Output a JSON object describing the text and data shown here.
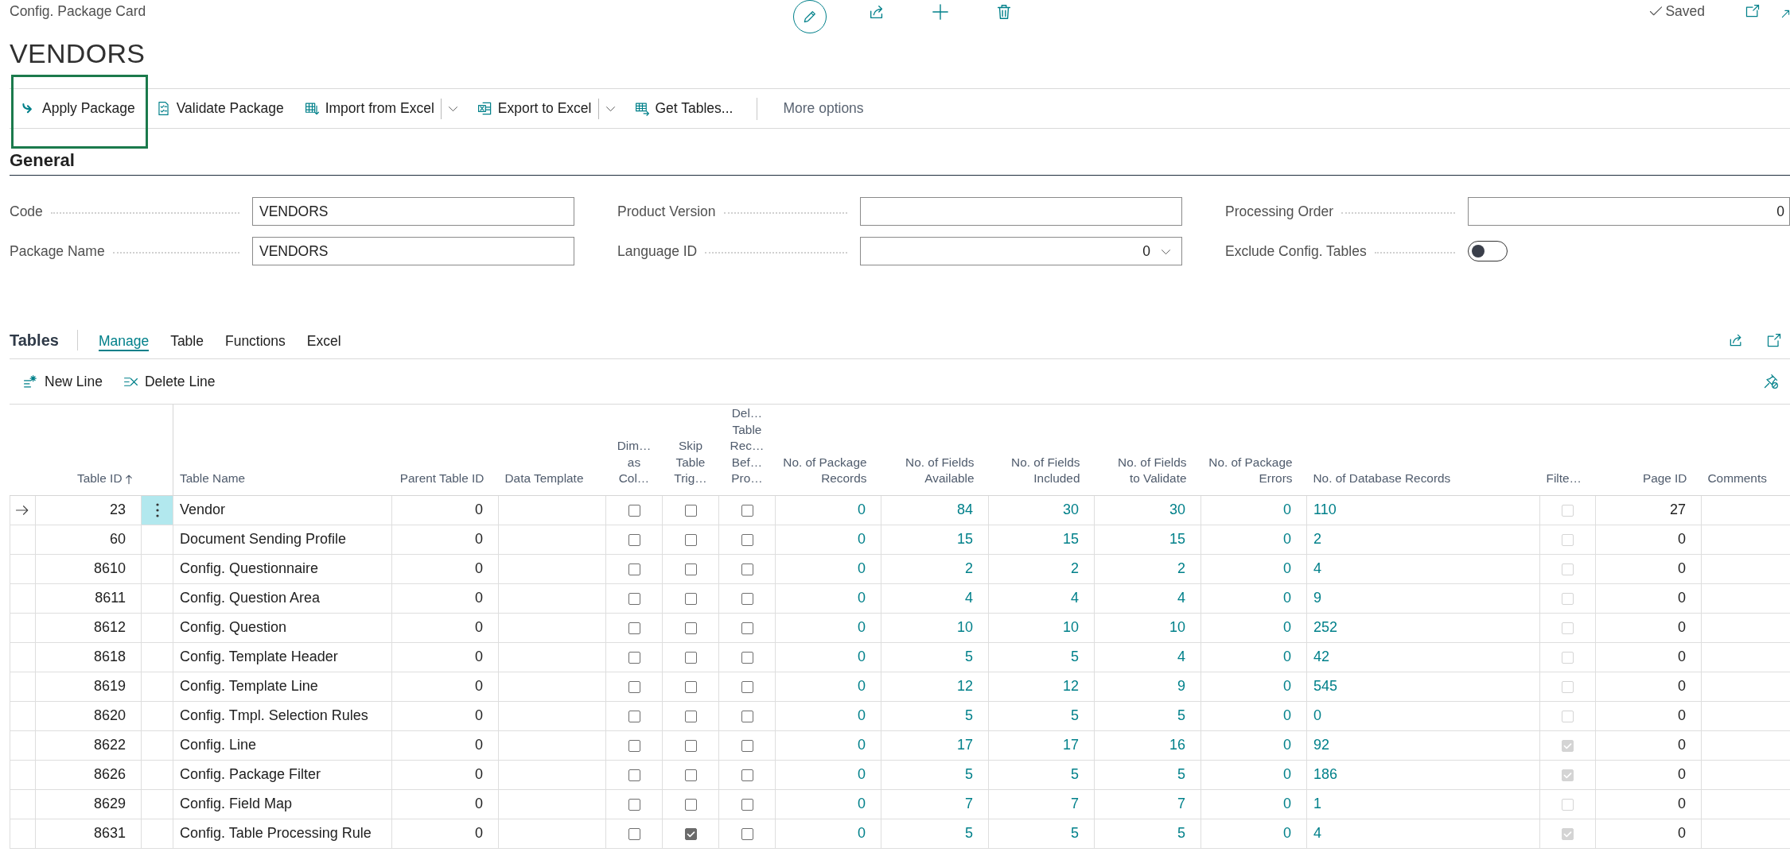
{
  "header": {
    "breadcrumb": "Config. Package Card",
    "status": "Saved",
    "title": "VENDORS"
  },
  "actions": [
    {
      "label": "Apply Package",
      "highlighted": true,
      "dropdown": false
    },
    {
      "label": "Validate Package",
      "highlighted": false,
      "dropdown": false
    },
    {
      "label": "Import from Excel",
      "highlighted": false,
      "dropdown": true
    },
    {
      "label": "Export to Excel",
      "highlighted": false,
      "dropdown": true
    },
    {
      "label": "Get Tables...",
      "highlighted": false,
      "dropdown": false
    }
  ],
  "more_options": "More options",
  "general": {
    "title": "General",
    "columns": [
      [
        {
          "label": "Code",
          "kind": "text",
          "value": "VENDORS"
        },
        {
          "label": "Package Name",
          "kind": "text",
          "value": "VENDORS"
        }
      ],
      [
        {
          "label": "Product Version",
          "kind": "text"
        },
        {
          "label": "Language ID",
          "kind": "dropdown",
          "value": "0"
        }
      ],
      [
        {
          "label": "Processing Order",
          "kind": "number",
          "value": "0"
        },
        {
          "label": "Exclude Config. Tables",
          "kind": "toggle",
          "on": false
        }
      ]
    ]
  },
  "tables": {
    "title": "Tables",
    "tabs": [
      {
        "label": "Manage",
        "selected": true
      },
      {
        "label": "Table",
        "selected": false
      },
      {
        "label": "Functions",
        "selected": false
      },
      {
        "label": "Excel",
        "selected": false
      }
    ],
    "actions": [
      "New Line",
      "Delete Line"
    ],
    "columns": [
      {
        "label": "Table ID",
        "kind": "number",
        "sorted": true
      },
      {
        "label": "Table Name",
        "kind": "text",
        "sorted": false
      },
      {
        "label": "Parent Table ID",
        "kind": "number",
        "sorted": false
      },
      {
        "label": "Data Template",
        "kind": "text",
        "sorted": false
      },
      {
        "label": "Dim… as Col…",
        "kind": "check",
        "sorted": false
      },
      {
        "label": "Skip Table Trig…",
        "kind": "check",
        "sorted": false
      },
      {
        "label": "Del… Table Rec… Bef… Pro…",
        "kind": "check",
        "sorted": false
      },
      {
        "label": "No. of Package Records",
        "kind": "link",
        "sorted": false
      },
      {
        "label": "No. of Fields Available",
        "kind": "link",
        "sorted": false
      },
      {
        "label": "No. of Fields Included",
        "kind": "link",
        "sorted": false
      },
      {
        "label": "No. of Fields to Validate",
        "kind": "link",
        "sorted": false
      },
      {
        "label": "No. of Package Errors",
        "kind": "link",
        "sorted": false
      },
      {
        "label": "No. of Database Records",
        "kind": "link_left",
        "sorted": false
      },
      {
        "label": "Filte…",
        "kind": "filter",
        "sorted": false
      },
      {
        "label": "Page ID",
        "kind": "number",
        "sorted": false
      },
      {
        "label": "Comments",
        "kind": "text",
        "sorted": false
      }
    ],
    "rows": [
      {
        "selected": true,
        "cells": [
          "23",
          "Vendor",
          "0",
          null,
          false,
          false,
          false,
          "0",
          "84",
          "30",
          "30",
          "0",
          "110",
          false,
          "27",
          null
        ]
      },
      {
        "selected": false,
        "cells": [
          "60",
          "Document Sending Profile",
          "0",
          null,
          false,
          false,
          false,
          "0",
          "15",
          "15",
          "15",
          "0",
          "2",
          false,
          "0",
          null
        ]
      },
      {
        "selected": false,
        "cells": [
          "8610",
          "Config. Questionnaire",
          "0",
          null,
          false,
          false,
          false,
          "0",
          "2",
          "2",
          "2",
          "0",
          "4",
          false,
          "0",
          null
        ]
      },
      {
        "selected": false,
        "cells": [
          "8611",
          "Config. Question Area",
          "0",
          null,
          false,
          false,
          false,
          "0",
          "4",
          "4",
          "4",
          "0",
          "9",
          false,
          "0",
          null
        ]
      },
      {
        "selected": false,
        "cells": [
          "8612",
          "Config. Question",
          "0",
          null,
          false,
          false,
          false,
          "0",
          "10",
          "10",
          "10",
          "0",
          "252",
          false,
          "0",
          null
        ]
      },
      {
        "selected": false,
        "cells": [
          "8618",
          "Config. Template Header",
          "0",
          null,
          false,
          false,
          false,
          "0",
          "5",
          "5",
          "4",
          "0",
          "42",
          false,
          "0",
          null
        ]
      },
      {
        "selected": false,
        "cells": [
          "8619",
          "Config. Template Line",
          "0",
          null,
          false,
          false,
          false,
          "0",
          "12",
          "12",
          "9",
          "0",
          "545",
          false,
          "0",
          null
        ]
      },
      {
        "selected": false,
        "cells": [
          "8620",
          "Config. Tmpl. Selection Rules",
          "0",
          null,
          false,
          false,
          false,
          "0",
          "5",
          "5",
          "5",
          "0",
          "0",
          false,
          "0",
          null
        ]
      },
      {
        "selected": false,
        "cells": [
          "8622",
          "Config. Line",
          "0",
          null,
          false,
          false,
          false,
          "0",
          "17",
          "17",
          "16",
          "0",
          "92",
          true,
          "0",
          null
        ]
      },
      {
        "selected": false,
        "cells": [
          "8626",
          "Config. Package Filter",
          "0",
          null,
          false,
          false,
          false,
          "0",
          "5",
          "5",
          "5",
          "0",
          "186",
          true,
          "0",
          null
        ]
      },
      {
        "selected": false,
        "cells": [
          "8629",
          "Config. Field Map",
          "0",
          null,
          false,
          false,
          false,
          "0",
          "7",
          "7",
          "7",
          "0",
          "1",
          false,
          "0",
          null
        ]
      },
      {
        "selected": false,
        "cells": [
          "8631",
          "Config. Table Processing Rule",
          "0",
          null,
          false,
          true,
          false,
          "0",
          "5",
          "5",
          "5",
          "0",
          "4",
          true,
          "0",
          null
        ]
      }
    ]
  }
}
